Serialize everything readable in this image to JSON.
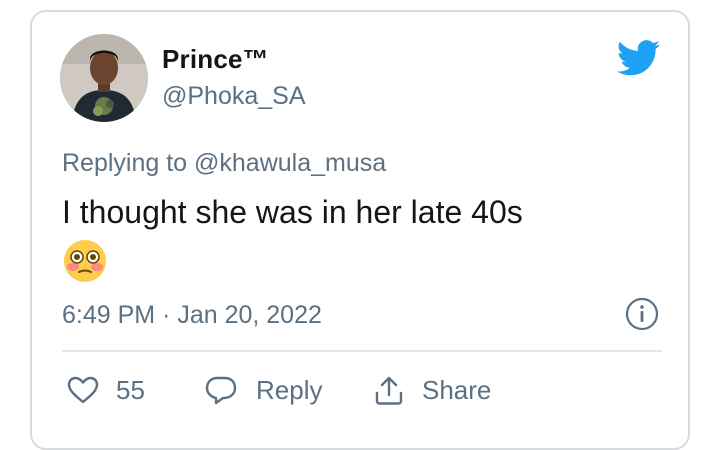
{
  "tweet": {
    "display_name": "Prince™",
    "handle": "@Phoka_SA",
    "replying_to": "Replying to @khawula_musa",
    "text": "I thought she was in her late 40s",
    "emoji": "flushed-face",
    "timestamp": "6:49 PM · Jan 20, 2022"
  },
  "actions": {
    "like_count": "55",
    "reply_label": "Reply",
    "share_label": "Share"
  },
  "icons": {
    "brand": "twitter-bird-icon",
    "info": "info-icon",
    "like": "heart-icon",
    "reply": "speech-bubble-icon",
    "share": "share-icon"
  },
  "colors": {
    "brand_blue": "#1da1f2",
    "secondary_text": "#5b7083",
    "primary_text": "#14171a",
    "border": "#d6dbe0"
  }
}
